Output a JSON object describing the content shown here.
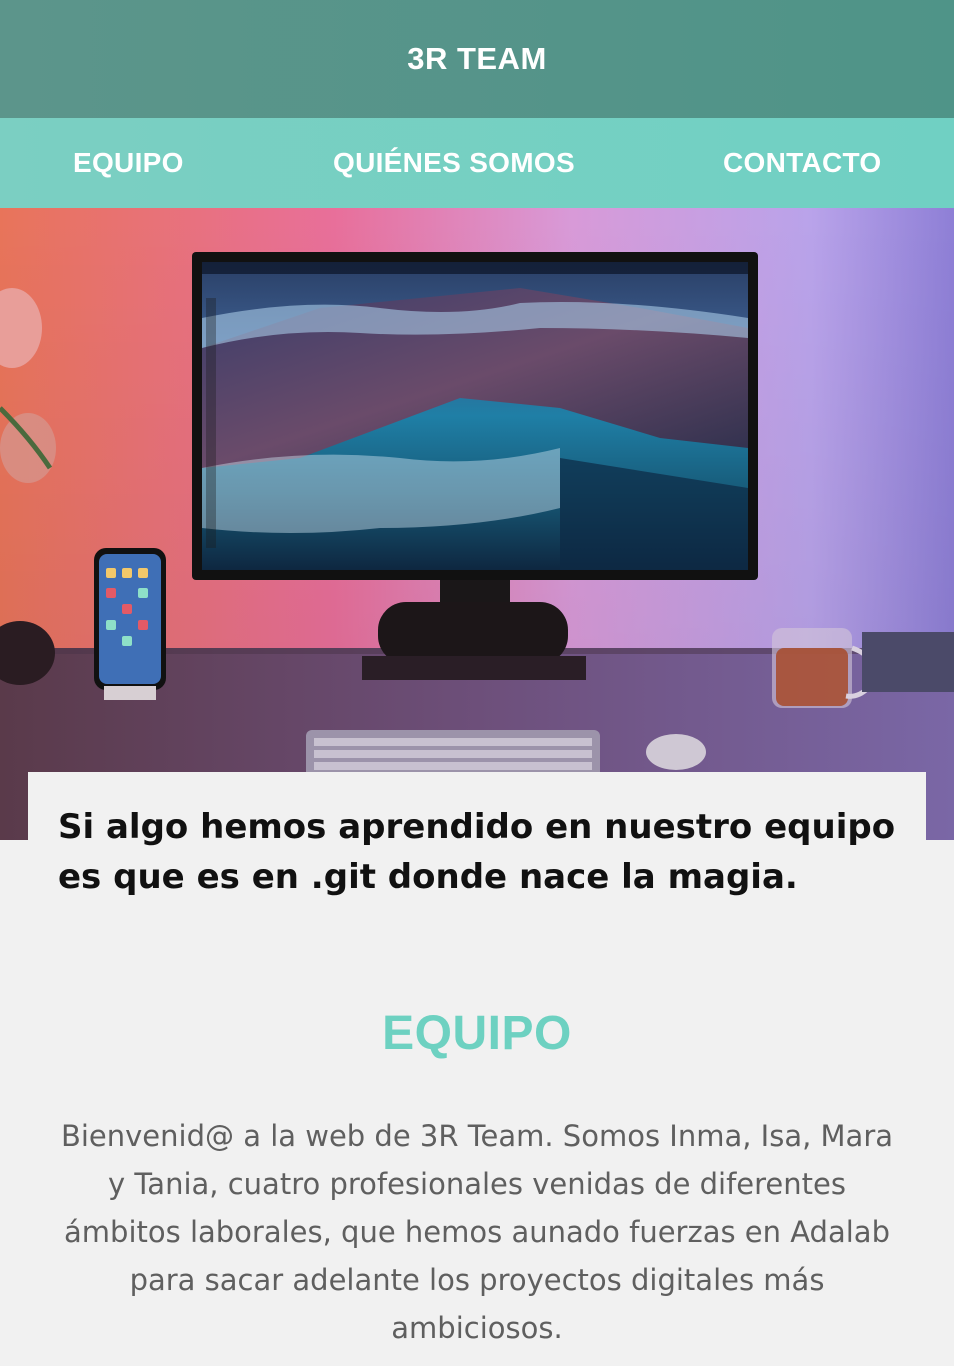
{
  "header": {
    "brand": "3R TEAM"
  },
  "nav": {
    "items": [
      {
        "label": "EQUIPO"
      },
      {
        "label": "QUIÉNES SOMOS"
      },
      {
        "label": "CONTACTO"
      }
    ]
  },
  "hero": {
    "image_icon": "desk-setup-photo",
    "quote": "Si algo hemos aprendido en nuestro equipo es que es en .git donde nace la magia."
  },
  "equipo": {
    "title": "EQUIPO",
    "body": "Bienvenid@ a la web de 3R Team. Somos Inma, Isa, Mara y Tania, cuatro profesionales venidas de diferentes ámbitos laborales, que hemos aunado fuerzas en Adalab para sacar adelante los proyectos digitales más ambiciosos."
  },
  "colors": {
    "topbar": "#4f9488",
    "navbar": "#70d0c3",
    "accent_title": "#6dd1c1",
    "body_text": "#5f5f5f",
    "page_bg": "#f1f1f1"
  }
}
